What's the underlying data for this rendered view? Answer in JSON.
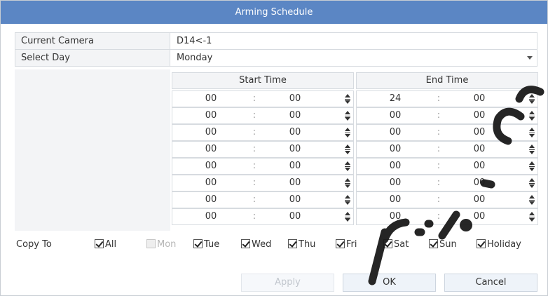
{
  "dialog": {
    "title": "Arming Schedule"
  },
  "info": {
    "camera_label": "Current Camera",
    "camera_value": "D14<-1",
    "day_label": "Select Day",
    "day_value": "Monday"
  },
  "grid": {
    "start_header": "Start Time",
    "end_header": "End Time",
    "separator": ":",
    "rows": [
      {
        "start_h": "00",
        "start_m": "00",
        "end_h": "24",
        "end_m": "00"
      },
      {
        "start_h": "00",
        "start_m": "00",
        "end_h": "00",
        "end_m": "00"
      },
      {
        "start_h": "00",
        "start_m": "00",
        "end_h": "00",
        "end_m": "00"
      },
      {
        "start_h": "00",
        "start_m": "00",
        "end_h": "00",
        "end_m": "00"
      },
      {
        "start_h": "00",
        "start_m": "00",
        "end_h": "00",
        "end_m": "00"
      },
      {
        "start_h": "00",
        "start_m": "00",
        "end_h": "00",
        "end_m": "00"
      },
      {
        "start_h": "00",
        "start_m": "00",
        "end_h": "00",
        "end_m": "00"
      },
      {
        "start_h": "00",
        "start_m": "00",
        "end_h": "00",
        "end_m": "00"
      }
    ]
  },
  "copy_to": {
    "label": "Copy To",
    "options": [
      {
        "label": "All",
        "checked": true,
        "disabled": false
      },
      {
        "label": "Mon",
        "checked": false,
        "disabled": true
      },
      {
        "label": "Tue",
        "checked": true,
        "disabled": false
      },
      {
        "label": "Wed",
        "checked": true,
        "disabled": false
      },
      {
        "label": "Thu",
        "checked": true,
        "disabled": false
      },
      {
        "label": "Fri",
        "checked": true,
        "disabled": false
      },
      {
        "label": "Sat",
        "checked": true,
        "disabled": false
      },
      {
        "label": "Sun",
        "checked": true,
        "disabled": false
      },
      {
        "label": "Holiday",
        "checked": true,
        "disabled": false
      }
    ]
  },
  "buttons": {
    "apply": "Apply",
    "ok": "OK",
    "cancel": "Cancel"
  },
  "colors": {
    "title_bar": "#5b86c4",
    "panel_bg": "#f3f4f6",
    "watermark": "#1a1a1a"
  }
}
